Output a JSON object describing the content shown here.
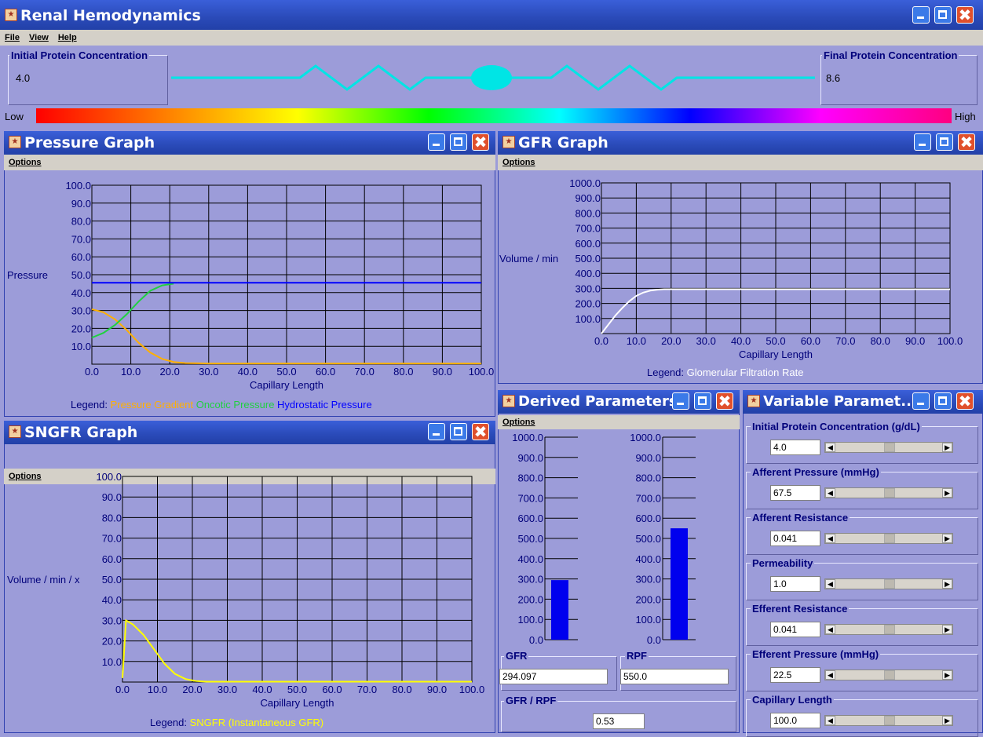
{
  "app": {
    "title": "Renal Hemodynamics",
    "menu": [
      "File",
      "View",
      "Help"
    ],
    "initial_protein": {
      "label": "Initial Protein Concentration",
      "value": "4.0"
    },
    "final_protein": {
      "label": "Final Protein Concentration",
      "value": "8.6"
    },
    "spectrum": {
      "low": "Low",
      "high": "High"
    }
  },
  "pressure_window": {
    "title": "Pressure Graph",
    "menu": "Options",
    "chart_data": {
      "type": "line",
      "xlabel": "Capillary Length",
      "ylabel": "Pressure",
      "xlim": [
        0,
        100
      ],
      "ylim": [
        0,
        100
      ],
      "x_ticks": [
        "0.0",
        "10.0",
        "20.0",
        "30.0",
        "40.0",
        "50.0",
        "60.0",
        "70.0",
        "80.0",
        "90.0",
        "100.0"
      ],
      "y_ticks": [
        "10.0",
        "20.0",
        "30.0",
        "40.0",
        "50.0",
        "60.0",
        "70.0",
        "80.0",
        "90.0",
        "100.0"
      ],
      "legend_prefix": "Legend:",
      "series": [
        {
          "name": "Pressure Gradient",
          "color": "#ffb000",
          "x": [
            0,
            3,
            6,
            9,
            12,
            15,
            18,
            21,
            24,
            30,
            40,
            100
          ],
          "y": [
            30.7,
            29,
            25,
            19,
            12,
            6.5,
            3,
            1.2,
            0.6,
            0.4,
            0.4,
            0.4
          ]
        },
        {
          "name": "Oncotic Pressure",
          "color": "#20d040",
          "x": [
            0,
            3,
            6,
            9,
            12,
            15,
            18,
            21
          ],
          "y": [
            14.8,
            17.5,
            22,
            28,
            35,
            41,
            44,
            45
          ]
        },
        {
          "name": "Hydrostatic Pressure",
          "color": "#0000ff",
          "x": [
            0,
            100
          ],
          "y": [
            45.5,
            45.5
          ]
        }
      ]
    }
  },
  "gfr_window": {
    "title": "GFR Graph",
    "menu": "Options",
    "chart_data": {
      "type": "line",
      "xlabel": "Capillary Length",
      "ylabel": "Volume / min",
      "xlim": [
        0,
        100
      ],
      "ylim": [
        0,
        1000
      ],
      "x_ticks": [
        "0.0",
        "10.0",
        "20.0",
        "30.0",
        "40.0",
        "50.0",
        "60.0",
        "70.0",
        "80.0",
        "90.0",
        "100.0"
      ],
      "y_ticks": [
        "100.0",
        "200.0",
        "300.0",
        "400.0",
        "500.0",
        "600.0",
        "700.0",
        "800.0",
        "900.0",
        "1000.0"
      ],
      "legend_prefix": "Legend:",
      "series": [
        {
          "name": "Glomerular Filtration Rate",
          "color": "#ffffff",
          "x": [
            0,
            2,
            4,
            6,
            8,
            10,
            12,
            14,
            16,
            18,
            20,
            30,
            100
          ],
          "y": [
            0,
            60,
            120,
            170,
            215,
            250,
            272,
            285,
            291,
            294,
            294,
            294,
            294
          ]
        }
      ]
    }
  },
  "sngfr_window": {
    "title": "SNGFR Graph",
    "menu": "Options",
    "chart_data": {
      "type": "line",
      "xlabel": "Capillary Length",
      "ylabel": "Volume / min / x",
      "xlim": [
        0,
        100
      ],
      "ylim": [
        0,
        100
      ],
      "x_ticks": [
        "0.0",
        "10.0",
        "20.0",
        "30.0",
        "40.0",
        "50.0",
        "60.0",
        "70.0",
        "80.0",
        "90.0",
        "100.0"
      ],
      "y_ticks": [
        "10.0",
        "20.0",
        "30.0",
        "40.0",
        "50.0",
        "60.0",
        "70.0",
        "80.0",
        "90.0",
        "100.0"
      ],
      "legend_prefix": "Legend:",
      "series": [
        {
          "name": "SNGFR (Instantaneous GFR)",
          "color": "#ffff00",
          "x": [
            0,
            1,
            3,
            6,
            9,
            12,
            15,
            18,
            21,
            24,
            30,
            100
          ],
          "y": [
            2,
            30,
            28,
            23,
            16,
            9,
            4,
            1.5,
            0.5,
            0.2,
            0.2,
            0.2
          ]
        }
      ]
    }
  },
  "derived_window": {
    "title": "Derived Parameters",
    "menu": "Options",
    "chart_data": [
      {
        "type": "bar",
        "categories": [
          "GFR"
        ],
        "values": [
          294.097
        ],
        "ylim": [
          0,
          1000
        ],
        "y_ticks": [
          "0.0",
          "100.0",
          "200.0",
          "300.0",
          "400.0",
          "500.0",
          "600.0",
          "700.0",
          "800.0",
          "900.0",
          "1000.0"
        ],
        "color": "#0000ee"
      },
      {
        "type": "bar",
        "categories": [
          "RPF"
        ],
        "values": [
          550.0
        ],
        "ylim": [
          0,
          1000
        ],
        "y_ticks": [
          "0.0",
          "100.0",
          "200.0",
          "300.0",
          "400.0",
          "500.0",
          "600.0",
          "700.0",
          "800.0",
          "900.0",
          "1000.0"
        ],
        "color": "#0000ee"
      }
    ],
    "gfr": {
      "label": "GFR",
      "value": "294.097"
    },
    "rpf": {
      "label": "RPF",
      "value": "550.0"
    },
    "ratio": {
      "label": "GFR / RPF",
      "value": "0.53"
    }
  },
  "variable_window": {
    "title": "Variable Paramet...",
    "params": [
      {
        "label": "Initial Protein Concentration (g/dL)",
        "value": "4.0",
        "level": 0.5
      },
      {
        "label": "Afferent Pressure (mmHg)",
        "value": "67.5",
        "level": 0.5
      },
      {
        "label": "Afferent Resistance",
        "value": "0.041",
        "level": 0.5
      },
      {
        "label": "Permeability",
        "value": "1.0",
        "level": 0.5
      },
      {
        "label": "Efferent Resistance",
        "value": "0.041",
        "level": 0.5
      },
      {
        "label": "Efferent Pressure (mmHg)",
        "value": "22.5",
        "level": 0.5
      },
      {
        "label": "Capillary Length",
        "value": "100.0",
        "level": 0.5
      }
    ]
  }
}
